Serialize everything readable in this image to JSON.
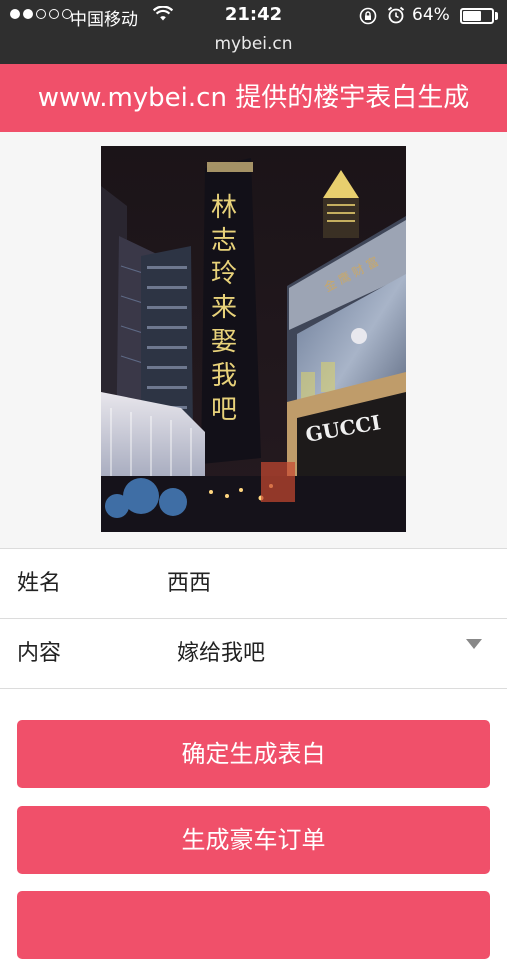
{
  "status_bar": {
    "carrier": "中国移动",
    "time": "21:42",
    "battery_percent": "64%",
    "battery_level": 0.64,
    "url": "mybei.cn"
  },
  "banner": {
    "title": "www.mybei.cn 提供的楼宇表白生成"
  },
  "photo": {
    "tower_message": "林志玲来娶我吧",
    "store_sign": "GUCCI",
    "colors": {
      "sky": "#1b1418",
      "led_text": "#e8d27a",
      "accent": "#f0506a"
    }
  },
  "form": {
    "name_label": "姓名",
    "name_value": "西西",
    "content_label": "内容",
    "content_value": "嫁给我吧"
  },
  "buttons": {
    "confirm": "确定生成表白",
    "order": "生成豪车订单",
    "third": ""
  }
}
